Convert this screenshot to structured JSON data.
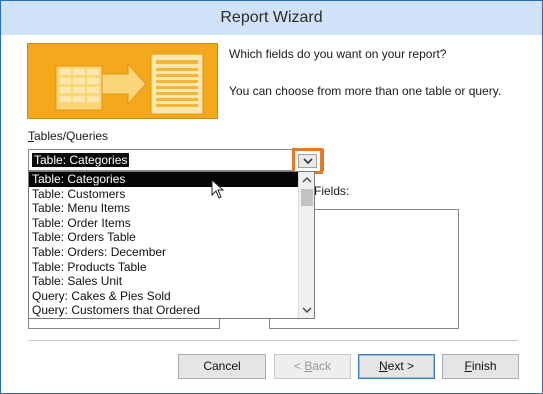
{
  "window": {
    "title": "Report Wizard"
  },
  "intro": {
    "line1": "Which fields do you want on your report?",
    "line2": "You can choose from more than one table or query."
  },
  "tables_queries": {
    "label_accel": "T",
    "label_rest": "ables/Queries",
    "selected": "Table: Categories",
    "options": [
      "Table: Categories",
      "Table: Customers",
      "Table: Menu Items",
      "Table: Order Items",
      "Table: Orders Table",
      "Table: Orders: December",
      "Table: Products Table",
      "Table: Sales Unit",
      "Query: Cakes & Pies Sold",
      "Query: Customers that Ordered"
    ]
  },
  "available_fields": {
    "label_partial": "Fields:"
  },
  "buttons": {
    "cancel": "Cancel",
    "back_prefix": "< ",
    "back_accel": "B",
    "back_rest": "ack",
    "next_accel": "N",
    "next_rest": "ext >",
    "finish_accel": "F",
    "finish_rest": "inish"
  },
  "colors": {
    "titlebar": "#cfe2f7",
    "window_border": "#2b6cb5",
    "banner": "#f4a91c",
    "highlight_box": "#e07a2a",
    "selection": "#050505"
  },
  "icons": {
    "banner": "report-wizard-graphic",
    "dropdown_arrow": "chevron-down-icon",
    "scroll_up": "scroll-up-icon",
    "scroll_down": "scroll-down-icon",
    "cursor": "mouse-pointer-icon"
  }
}
